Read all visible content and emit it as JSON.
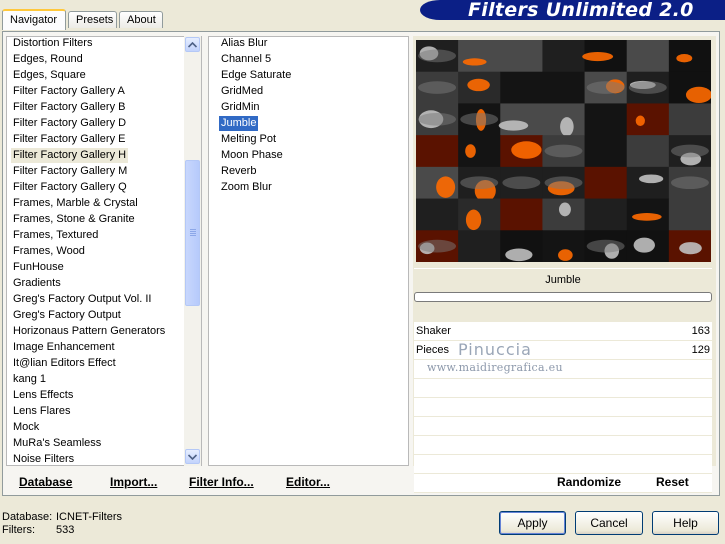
{
  "tabs": [
    {
      "label": "Navigator",
      "active": true
    },
    {
      "label": "Presets",
      "active": false
    },
    {
      "label": "About",
      "active": false
    }
  ],
  "app_title": "Filters Unlimited 2.0",
  "categories": [
    "Distortion Filters",
    "Edges, Round",
    "Edges, Square",
    "Filter Factory Gallery A",
    "Filter Factory Gallery B",
    "Filter Factory Gallery D",
    "Filter Factory Gallery E",
    "Filter Factory Gallery H",
    "Filter Factory Gallery M",
    "Filter Factory Gallery Q",
    "Frames, Marble & Crystal",
    "Frames, Stone & Granite",
    "Frames, Textured",
    "Frames, Wood",
    "FunHouse",
    "Gradients",
    "Greg's Factory Output Vol. II",
    "Greg's Factory Output",
    "Horizonaus Pattern Generators",
    "Image Enhancement",
    "It@lian Editors Effect",
    "kang 1",
    "Lens Effects",
    "Lens Flares",
    "Mock",
    "MuRa's Seamless",
    "Noise Filters"
  ],
  "selected_category": "Filter Factory Gallery H",
  "filters": [
    "Alias Blur",
    "Channel 5",
    "Edge Saturate",
    "GridMed",
    "GridMin",
    "Jumble",
    "Melting Pot",
    "Moon Phase",
    "Reverb",
    "Zoom Blur"
  ],
  "selected_filter": "Jumble",
  "preview_filter_name": "Jumble",
  "parameters": [
    {
      "name": "Shaker",
      "value": "163"
    },
    {
      "name": "Pieces",
      "value": "129"
    }
  ],
  "watermark": {
    "name": "Pinuccia",
    "url": "www.maidiregrafica.eu"
  },
  "toolbar": {
    "database": "Database",
    "import": "Import...",
    "filter_info": "Filter Info...",
    "editor": "Editor...",
    "randomize": "Randomize",
    "reset": "Reset"
  },
  "status": {
    "database_label": "Database:",
    "database_value": "ICNET-Filters",
    "filters_label": "Filters:",
    "filters_value": "533"
  },
  "buttons": {
    "apply": "Apply",
    "cancel": "Cancel",
    "help": "Help"
  },
  "colors": {
    "banner": "#0b1f86",
    "selection": "#316ac5",
    "accent_orange": "#ff6a00"
  }
}
